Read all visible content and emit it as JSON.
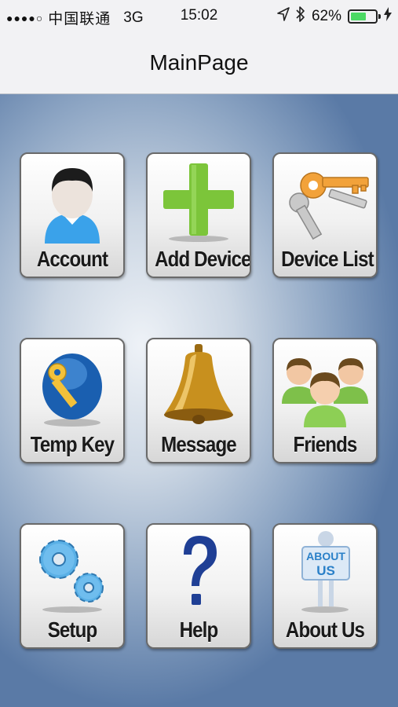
{
  "status_bar": {
    "signal": "●●●●○",
    "carrier": "中国联通",
    "network": "3G",
    "time": "15:02",
    "location_icon": "location-arrow-icon",
    "bluetooth_icon": "bluetooth-icon",
    "battery_percent": "62%",
    "battery_level": 0.62,
    "charging_icon": "charging-bolt-icon"
  },
  "nav": {
    "title": "MainPage"
  },
  "tiles": [
    {
      "label": "Account",
      "icon": "account-person-icon"
    },
    {
      "label": "Add Device",
      "icon": "green-plus-icon"
    },
    {
      "label": "Device List",
      "icon": "keys-icon"
    },
    {
      "label": "Temp Key",
      "icon": "key-globe-icon"
    },
    {
      "label": "Message",
      "icon": "bell-icon"
    },
    {
      "label": "Friends",
      "icon": "friends-group-icon"
    },
    {
      "label": "Setup",
      "icon": "gears-icon"
    },
    {
      "label": "Help",
      "icon": "question-mark-icon"
    },
    {
      "label": "About Us",
      "icon": "about-us-sign-icon"
    }
  ],
  "icon_texts": {
    "about_us_sign": [
      "ABOUT",
      "US"
    ]
  },
  "colors": {
    "battery_green": "#4cd964",
    "plus_green": "#7cc53a",
    "key_orange": "#f2a23a",
    "shirt_blue": "#3aa2ea",
    "friends_shirt": "#7ec04a",
    "bell_gold": "#c8901e",
    "help_blue": "#1f3f95",
    "gear_blue": "#5ab0e6"
  }
}
